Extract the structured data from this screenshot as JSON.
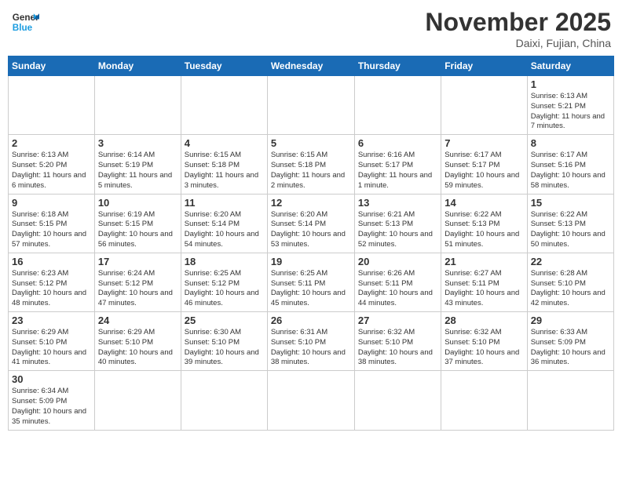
{
  "header": {
    "logo_general": "General",
    "logo_blue": "Blue",
    "month_year": "November 2025",
    "location": "Daixi, Fujian, China"
  },
  "days_of_week": [
    "Sunday",
    "Monday",
    "Tuesday",
    "Wednesday",
    "Thursday",
    "Friday",
    "Saturday"
  ],
  "weeks": [
    [
      null,
      null,
      null,
      null,
      null,
      null,
      {
        "day": "1",
        "sunrise": "Sunrise: 6:13 AM",
        "sunset": "Sunset: 5:21 PM",
        "daylight": "Daylight: 11 hours and 7 minutes."
      }
    ],
    [
      {
        "day": "2",
        "sunrise": "Sunrise: 6:13 AM",
        "sunset": "Sunset: 5:20 PM",
        "daylight": "Daylight: 11 hours and 6 minutes."
      },
      {
        "day": "3",
        "sunrise": "Sunrise: 6:14 AM",
        "sunset": "Sunset: 5:19 PM",
        "daylight": "Daylight: 11 hours and 5 minutes."
      },
      {
        "day": "4",
        "sunrise": "Sunrise: 6:15 AM",
        "sunset": "Sunset: 5:18 PM",
        "daylight": "Daylight: 11 hours and 3 minutes."
      },
      {
        "day": "5",
        "sunrise": "Sunrise: 6:15 AM",
        "sunset": "Sunset: 5:18 PM",
        "daylight": "Daylight: 11 hours and 2 minutes."
      },
      {
        "day": "6",
        "sunrise": "Sunrise: 6:16 AM",
        "sunset": "Sunset: 5:17 PM",
        "daylight": "Daylight: 11 hours and 1 minute."
      },
      {
        "day": "7",
        "sunrise": "Sunrise: 6:17 AM",
        "sunset": "Sunset: 5:17 PM",
        "daylight": "Daylight: 10 hours and 59 minutes."
      },
      {
        "day": "8",
        "sunrise": "Sunrise: 6:17 AM",
        "sunset": "Sunset: 5:16 PM",
        "daylight": "Daylight: 10 hours and 58 minutes."
      }
    ],
    [
      {
        "day": "9",
        "sunrise": "Sunrise: 6:18 AM",
        "sunset": "Sunset: 5:15 PM",
        "daylight": "Daylight: 10 hours and 57 minutes."
      },
      {
        "day": "10",
        "sunrise": "Sunrise: 6:19 AM",
        "sunset": "Sunset: 5:15 PM",
        "daylight": "Daylight: 10 hours and 56 minutes."
      },
      {
        "day": "11",
        "sunrise": "Sunrise: 6:20 AM",
        "sunset": "Sunset: 5:14 PM",
        "daylight": "Daylight: 10 hours and 54 minutes."
      },
      {
        "day": "12",
        "sunrise": "Sunrise: 6:20 AM",
        "sunset": "Sunset: 5:14 PM",
        "daylight": "Daylight: 10 hours and 53 minutes."
      },
      {
        "day": "13",
        "sunrise": "Sunrise: 6:21 AM",
        "sunset": "Sunset: 5:13 PM",
        "daylight": "Daylight: 10 hours and 52 minutes."
      },
      {
        "day": "14",
        "sunrise": "Sunrise: 6:22 AM",
        "sunset": "Sunset: 5:13 PM",
        "daylight": "Daylight: 10 hours and 51 minutes."
      },
      {
        "day": "15",
        "sunrise": "Sunrise: 6:22 AM",
        "sunset": "Sunset: 5:13 PM",
        "daylight": "Daylight: 10 hours and 50 minutes."
      }
    ],
    [
      {
        "day": "16",
        "sunrise": "Sunrise: 6:23 AM",
        "sunset": "Sunset: 5:12 PM",
        "daylight": "Daylight: 10 hours and 48 minutes."
      },
      {
        "day": "17",
        "sunrise": "Sunrise: 6:24 AM",
        "sunset": "Sunset: 5:12 PM",
        "daylight": "Daylight: 10 hours and 47 minutes."
      },
      {
        "day": "18",
        "sunrise": "Sunrise: 6:25 AM",
        "sunset": "Sunset: 5:12 PM",
        "daylight": "Daylight: 10 hours and 46 minutes."
      },
      {
        "day": "19",
        "sunrise": "Sunrise: 6:25 AM",
        "sunset": "Sunset: 5:11 PM",
        "daylight": "Daylight: 10 hours and 45 minutes."
      },
      {
        "day": "20",
        "sunrise": "Sunrise: 6:26 AM",
        "sunset": "Sunset: 5:11 PM",
        "daylight": "Daylight: 10 hours and 44 minutes."
      },
      {
        "day": "21",
        "sunrise": "Sunrise: 6:27 AM",
        "sunset": "Sunset: 5:11 PM",
        "daylight": "Daylight: 10 hours and 43 minutes."
      },
      {
        "day": "22",
        "sunrise": "Sunrise: 6:28 AM",
        "sunset": "Sunset: 5:10 PM",
        "daylight": "Daylight: 10 hours and 42 minutes."
      }
    ],
    [
      {
        "day": "23",
        "sunrise": "Sunrise: 6:29 AM",
        "sunset": "Sunset: 5:10 PM",
        "daylight": "Daylight: 10 hours and 41 minutes."
      },
      {
        "day": "24",
        "sunrise": "Sunrise: 6:29 AM",
        "sunset": "Sunset: 5:10 PM",
        "daylight": "Daylight: 10 hours and 40 minutes."
      },
      {
        "day": "25",
        "sunrise": "Sunrise: 6:30 AM",
        "sunset": "Sunset: 5:10 PM",
        "daylight": "Daylight: 10 hours and 39 minutes."
      },
      {
        "day": "26",
        "sunrise": "Sunrise: 6:31 AM",
        "sunset": "Sunset: 5:10 PM",
        "daylight": "Daylight: 10 hours and 38 minutes."
      },
      {
        "day": "27",
        "sunrise": "Sunrise: 6:32 AM",
        "sunset": "Sunset: 5:10 PM",
        "daylight": "Daylight: 10 hours and 38 minutes."
      },
      {
        "day": "28",
        "sunrise": "Sunrise: 6:32 AM",
        "sunset": "Sunset: 5:10 PM",
        "daylight": "Daylight: 10 hours and 37 minutes."
      },
      {
        "day": "29",
        "sunrise": "Sunrise: 6:33 AM",
        "sunset": "Sunset: 5:09 PM",
        "daylight": "Daylight: 10 hours and 36 minutes."
      }
    ],
    [
      {
        "day": "30",
        "sunrise": "Sunrise: 6:34 AM",
        "sunset": "Sunset: 5:09 PM",
        "daylight": "Daylight: 10 hours and 35 minutes."
      },
      null,
      null,
      null,
      null,
      null,
      null
    ]
  ]
}
